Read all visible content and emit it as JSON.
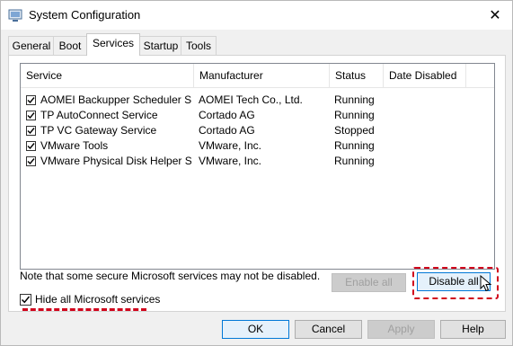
{
  "window": {
    "title": "System Configuration",
    "close_glyph": "✕"
  },
  "tabs": [
    {
      "label": "General"
    },
    {
      "label": "Boot"
    },
    {
      "label": "Services"
    },
    {
      "label": "Startup"
    },
    {
      "label": "Tools"
    }
  ],
  "active_tab": "Services",
  "services_table": {
    "columns": [
      "Service",
      "Manufacturer",
      "Status",
      "Date Disabled"
    ],
    "rows": [
      {
        "checked": true,
        "service": "AOMEI Backupper Scheduler Ser...",
        "manufacturer": "AOMEI Tech Co., Ltd.",
        "status": "Running",
        "date_disabled": ""
      },
      {
        "checked": true,
        "service": "TP AutoConnect Service",
        "manufacturer": "Cortado AG",
        "status": "Running",
        "date_disabled": ""
      },
      {
        "checked": true,
        "service": "TP VC Gateway Service",
        "manufacturer": "Cortado AG",
        "status": "Stopped",
        "date_disabled": ""
      },
      {
        "checked": true,
        "service": "VMware Tools",
        "manufacturer": "VMware, Inc.",
        "status": "Running",
        "date_disabled": ""
      },
      {
        "checked": true,
        "service": "VMware Physical Disk Helper Ser...",
        "manufacturer": "VMware, Inc.",
        "status": "Running",
        "date_disabled": ""
      }
    ]
  },
  "note": "Note that some secure Microsoft services may not be disabled.",
  "enable_all_label": "Enable all",
  "disable_all_label": "Disable all",
  "hide_ms_label": "Hide all Microsoft services",
  "hide_ms_checked": true,
  "footer": {
    "ok": "OK",
    "cancel": "Cancel",
    "apply": "Apply",
    "help": "Help"
  },
  "colors": {
    "highlight": "#d0021b",
    "focus_border": "#0078d7"
  },
  "icons": [
    "system-config-icon",
    "close-icon",
    "checkbox-checked-icon",
    "mouse-cursor-icon"
  ]
}
